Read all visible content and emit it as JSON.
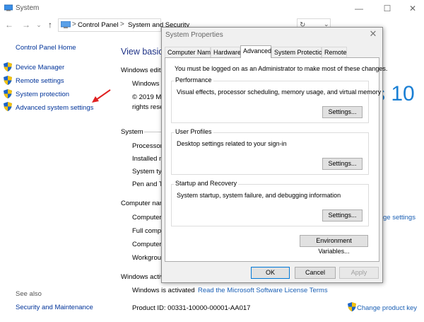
{
  "window": {
    "title": "System",
    "minimize": "—",
    "maximize": "☐",
    "close": "✕"
  },
  "nav": {
    "back": "←",
    "forward": "→",
    "up": "↑"
  },
  "breadcrumb": {
    "items": [
      "Control Panel",
      "System and Security",
      "System"
    ],
    "separator": ">"
  },
  "sidebar": {
    "home": "Control Panel Home",
    "items": [
      {
        "label": "Device Manager",
        "icon": "shield-icon"
      },
      {
        "label": "Remote settings",
        "icon": "shield-icon"
      },
      {
        "label": "System protection",
        "icon": "shield-icon"
      },
      {
        "label": "Advanced system settings",
        "icon": "shield-icon"
      }
    ],
    "see_also": "See also",
    "security": "Security and Maintenance"
  },
  "main": {
    "heading": "View basic",
    "windows_edition": "Windows editi",
    "windows_label": "Windows",
    "copyright_1": "© 2019 M",
    "copyright_2": "rights rese",
    "logo_text": "s 10",
    "system_section": "System",
    "processor": "Processor",
    "installed": "Installed m",
    "system_type": "System typ",
    "pen": "Pen and To",
    "computer_section": "Computer nar",
    "computer_1": "Computer",
    "full_computer": "Full compu",
    "computer_2": "Computer",
    "workgroup": "Workgrou",
    "change_settings": "ge settings",
    "activation_section": "Windows activ",
    "activated": "Windows is activated",
    "license_link": "Read the Microsoft Software License Terms",
    "product_id": "Product ID: 00331-10000-00001-AA017",
    "change_key": "Change product key"
  },
  "dialog": {
    "title": "System Properties",
    "close": "✕",
    "tabs": [
      "Computer Name",
      "Hardware",
      "Advanced",
      "System Protection",
      "Remote"
    ],
    "active_tab": "Advanced",
    "admin_note": "You must be logged on as an Administrator to make most of these changes.",
    "performance": {
      "title": "Performance",
      "desc": "Visual effects, processor scheduling, memory usage, and virtual memory",
      "button": "Settings..."
    },
    "profiles": {
      "title": "User Profiles",
      "desc": "Desktop settings related to your sign-in",
      "button": "Settings..."
    },
    "startup": {
      "title": "Startup and Recovery",
      "desc": "System startup, system failure, and debugging information",
      "button": "Settings..."
    },
    "env_button": "Environment Variables...",
    "ok": "OK",
    "cancel": "Cancel",
    "apply": "Apply"
  },
  "colors": {
    "link": "#003399",
    "accent": "#0078d7",
    "arrow": "#e02020"
  }
}
